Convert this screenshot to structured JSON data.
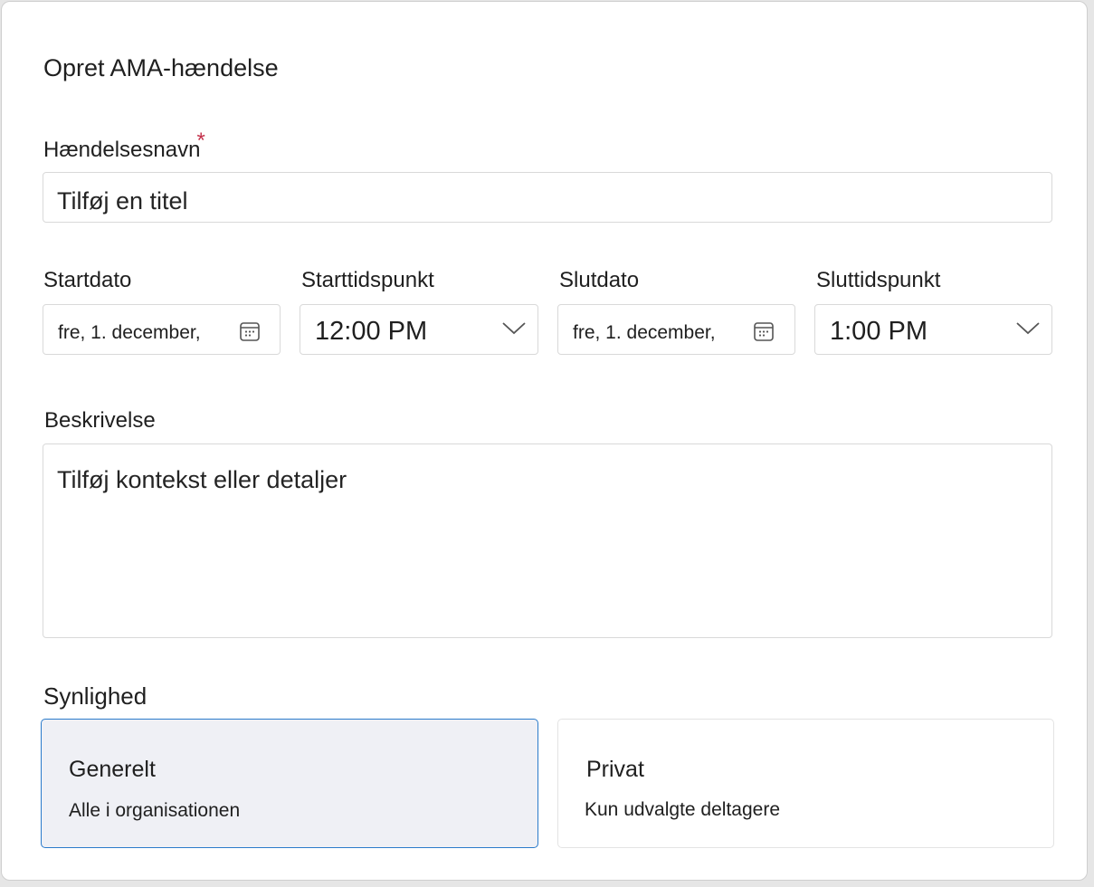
{
  "dialog": {
    "title": "Opret AMA-hændelse"
  },
  "event_name": {
    "label": "Hændelsesnavn",
    "required_marker": "*",
    "placeholder": "Tilføj en titel"
  },
  "start_date": {
    "label": "Startdato",
    "value": "fre, 1. december,",
    "icon": "calendar-icon"
  },
  "start_time": {
    "label": "Starttidspunkt",
    "value": "12:00 PM",
    "icon": "chevron-down-icon"
  },
  "end_date": {
    "label": "Slutdato",
    "value": "fre, 1. december,",
    "icon": "calendar-icon"
  },
  "end_time": {
    "label": "Sluttidspunkt",
    "value": "1:00 PM",
    "icon": "chevron-down-icon"
  },
  "description": {
    "label": "Beskrivelse",
    "placeholder": "Tilføj kontekst eller detaljer"
  },
  "visibility": {
    "label": "Synlighed",
    "options": [
      {
        "title": "Generelt",
        "subtitle": "Alle i organisationen",
        "selected": true
      },
      {
        "title": "Privat",
        "subtitle": "Kun udvalgte deltagere",
        "selected": false
      }
    ]
  },
  "colors": {
    "required": "#c4314b",
    "selected_border": "#2b7bcb",
    "selected_bg": "#eff0f5",
    "field_border": "#d9d9d9"
  }
}
